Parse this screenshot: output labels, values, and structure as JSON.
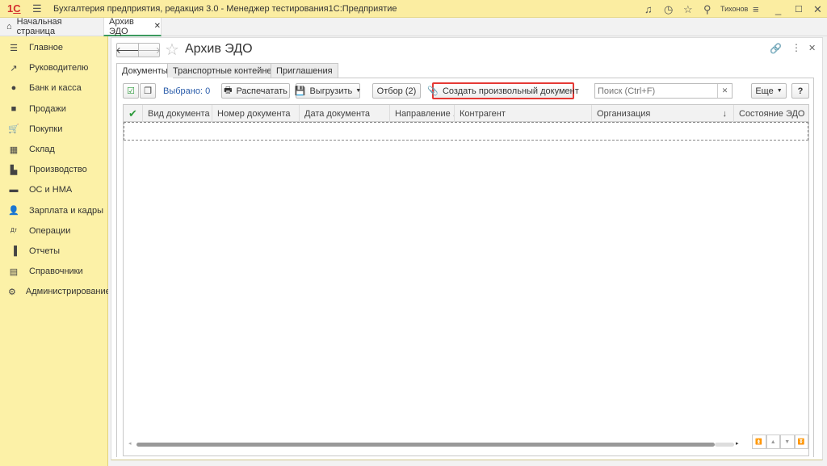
{
  "titlebar": {
    "title": "Бухгалтерия предприятия, редакция 3.0  - Менеджер тестирования1С:Предприятие",
    "user": "Тихонов",
    "logo": "1С"
  },
  "tabs": [
    {
      "label": "Начальная страница"
    },
    {
      "label": "Архив ЭДО"
    }
  ],
  "sidebar": {
    "items": [
      {
        "label": "Главное",
        "icon": "menu-icon"
      },
      {
        "label": "Руководителю",
        "icon": "trend-icon"
      },
      {
        "label": "Банк и касса",
        "icon": "ruble-icon"
      },
      {
        "label": "Продажи",
        "icon": "bag-icon"
      },
      {
        "label": "Покупки",
        "icon": "cart-icon"
      },
      {
        "label": "Склад",
        "icon": "warehouse-icon"
      },
      {
        "label": "Производство",
        "icon": "factory-icon"
      },
      {
        "label": "ОС и НМА",
        "icon": "truck-icon"
      },
      {
        "label": "Зарплата и кадры",
        "icon": "person-icon"
      },
      {
        "label": "Операции",
        "icon": "dt-kt-icon"
      },
      {
        "label": "Отчеты",
        "icon": "bar-chart-icon"
      },
      {
        "label": "Справочники",
        "icon": "books-icon"
      },
      {
        "label": "Администрирование",
        "icon": "gear-icon"
      }
    ]
  },
  "form": {
    "title": "Архив ЭДО",
    "tabs": [
      {
        "label": "Документы"
      },
      {
        "label": "Транспортные контейнеры"
      },
      {
        "label": "Приглашения"
      }
    ],
    "toolbar": {
      "selected": "Выбрано: 0",
      "print": "Распечатать",
      "export": "Выгрузить",
      "filter": "Отбор (2)",
      "create": "Создать произвольный документ",
      "search_placeholder": "Поиск (Ctrl+F)",
      "more": "Еще",
      "help": "?"
    },
    "columns": [
      "Вид документа",
      "Номер документа",
      "Дата документа",
      "Направление ...",
      "Контрагент",
      "Организация",
      "Состояние ЭДО"
    ],
    "sort_indicator": "↓",
    "rows": []
  },
  "colors": {
    "titlebar": "#fbeda1",
    "sidebar": "#fcf1a7",
    "highlight": "#e53935",
    "link": "#2a5caa",
    "check": "#2e9b3c"
  }
}
